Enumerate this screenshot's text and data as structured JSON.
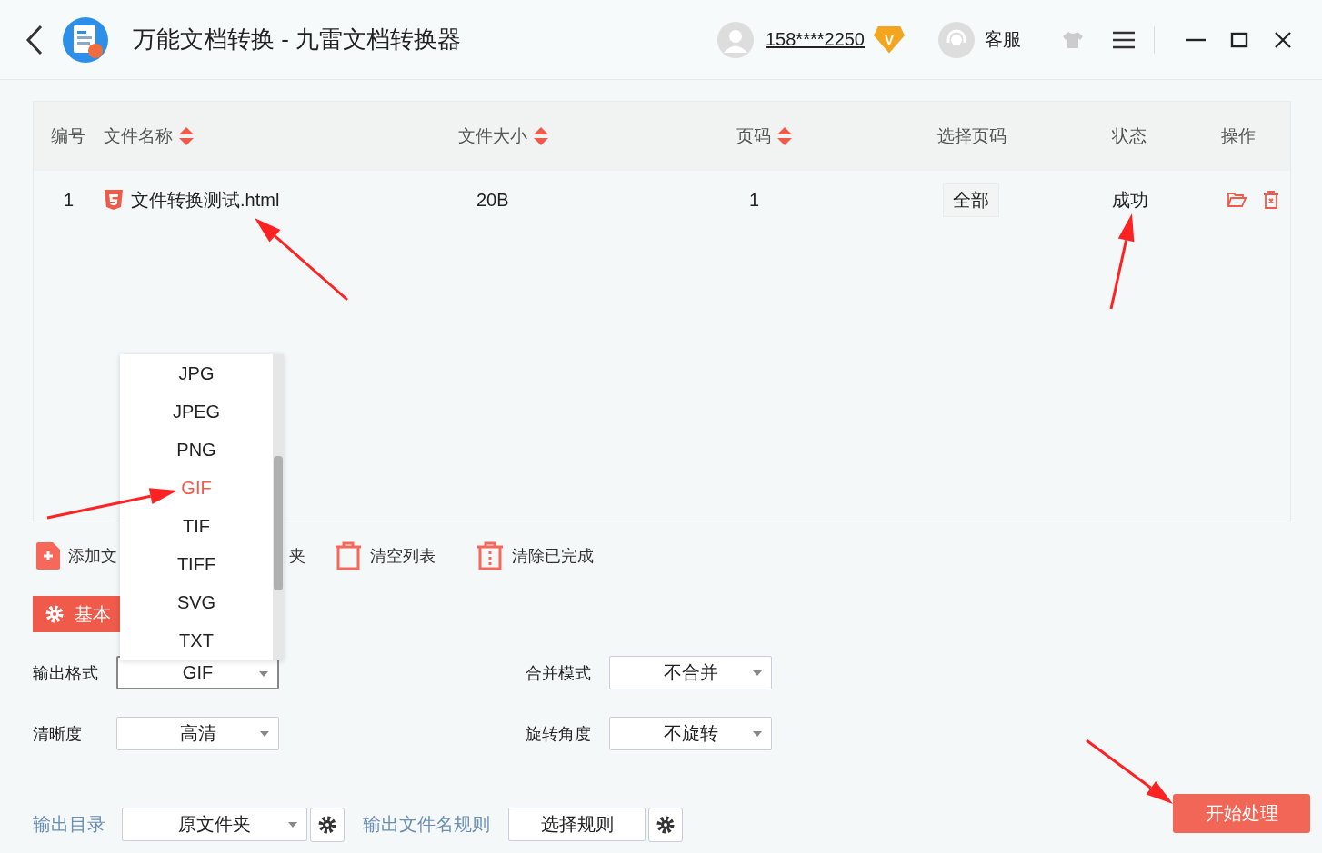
{
  "window": {
    "title": "万能文档转换 - 九雷文档转换器"
  },
  "account": {
    "phone": "158****2250",
    "vip_badge": "V",
    "support": "客服"
  },
  "table": {
    "columns": [
      {
        "label": "编号",
        "sortable": false
      },
      {
        "label": "文件名称",
        "sortable": true
      },
      {
        "label": "文件大小",
        "sortable": true
      },
      {
        "label": "页码",
        "sortable": true
      },
      {
        "label": "选择页码",
        "sortable": false
      },
      {
        "label": "状态",
        "sortable": false
      },
      {
        "label": "操作",
        "sortable": false
      }
    ],
    "rows": [
      {
        "index": "1",
        "file_name": "文件转换测试.html",
        "size": "20B",
        "pages": "1",
        "page_select": "全部",
        "status": "成功"
      }
    ]
  },
  "toolbar": [
    {
      "label": "添加文",
      "kind": "add"
    },
    {
      "label": "夹",
      "kind": "fragment"
    },
    {
      "label": "清空列表",
      "kind": "clear"
    },
    {
      "label": "清除已完成",
      "kind": "clear-done"
    }
  ],
  "settings_tab": {
    "label": "基本"
  },
  "format_menu": {
    "options": [
      {
        "label": "JPG",
        "selected": false
      },
      {
        "label": "JPEG",
        "selected": false
      },
      {
        "label": "PNG",
        "selected": false
      },
      {
        "label": "GIF",
        "selected": true
      },
      {
        "label": "TIF",
        "selected": false
      },
      {
        "label": "TIFF",
        "selected": false
      },
      {
        "label": "SVG",
        "selected": false
      },
      {
        "label": "TXT",
        "selected": false
      }
    ]
  },
  "settings": [
    {
      "label": "输出格式",
      "value": "GIF"
    },
    {
      "label": "合并模式",
      "value": "不合并"
    },
    {
      "label": "清晰度",
      "value": "高清"
    },
    {
      "label": "旋转角度",
      "value": "不旋转"
    }
  ],
  "output": {
    "dir_label": "输出目录",
    "dir_value": "原文件夹",
    "rule_label": "输出文件名规则",
    "rule_value": "选择规则"
  },
  "start_button": "开始处理"
}
